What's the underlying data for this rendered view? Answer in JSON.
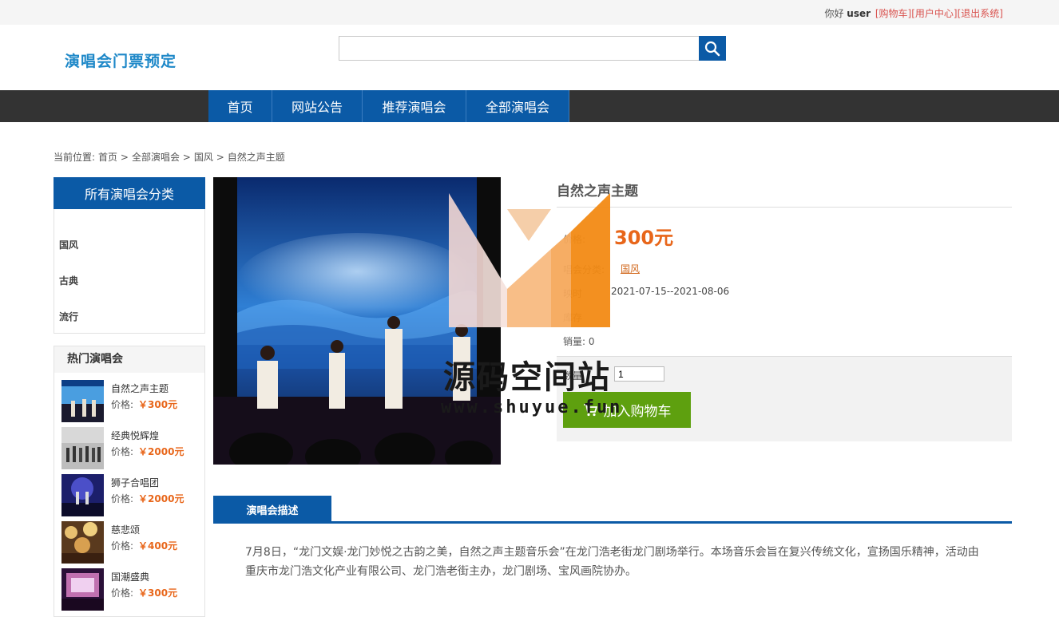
{
  "topbar": {
    "greeting": "你好",
    "username": "user",
    "cart_link": "[购物车]",
    "user_center_link": "[用户中心]",
    "logout_link": "[退出系统]"
  },
  "header": {
    "logo": "演唱会门票预定",
    "search_placeholder": "",
    "search_value": ""
  },
  "nav": {
    "items": [
      {
        "label": "首页"
      },
      {
        "label": "网站公告"
      },
      {
        "label": "推荐演唱会"
      },
      {
        "label": "全部演唱会"
      }
    ]
  },
  "breadcrumb": {
    "prefix": "当前位置:",
    "items": [
      "首页",
      "全部演唱会",
      "国风",
      "自然之声主题"
    ],
    "separator": ">"
  },
  "sidebar": {
    "category_title": "所有演唱会分类",
    "categories": [
      "国风",
      "古典",
      "流行"
    ],
    "hot_title": "热门演唱会",
    "price_label": "价格:",
    "hot_items": [
      {
        "name": "自然之声主题",
        "price": "￥300元"
      },
      {
        "name": "经典悦辉煌",
        "price": "￥2000元"
      },
      {
        "name": "狮子合唱团",
        "price": "￥2000元"
      },
      {
        "name": "慈悲颂",
        "price": "￥400元"
      },
      {
        "name": "国潮盛典",
        "price": "￥300元"
      }
    ]
  },
  "product": {
    "title": "自然之声主题",
    "price_label": "价格:",
    "price": "300元",
    "category_label": "唱会分类:",
    "category": "国风",
    "date_label": "映时",
    "dates": "2021-07-15--2021-08-06",
    "stock_label": "库存",
    "sales_label": "销量:",
    "sales": "0",
    "quantity_label": "数量",
    "quantity": "1",
    "add_to_cart": "加入购物车"
  },
  "description": {
    "tab_label": "演唱会描述",
    "text": "7月8日，“龙门文娱·龙门妙悦之古韵之美，自然之声主题音乐会”在龙门浩老街龙门剧场举行。本场音乐会旨在复兴传统文化，宣扬国乐精神，活动由重庆市龙门浩文化产业有限公司、龙门浩老街主办，龙门剧场、宝风画院协办。"
  },
  "watermark": {
    "text": "源码空间站",
    "url": "www.shuyue.fun"
  },
  "colors": {
    "primary": "#0b5aa6",
    "nav_bg": "#333333",
    "price": "#e8661a",
    "cart_button": "#5ea00f",
    "logo": "#1e88c8"
  }
}
